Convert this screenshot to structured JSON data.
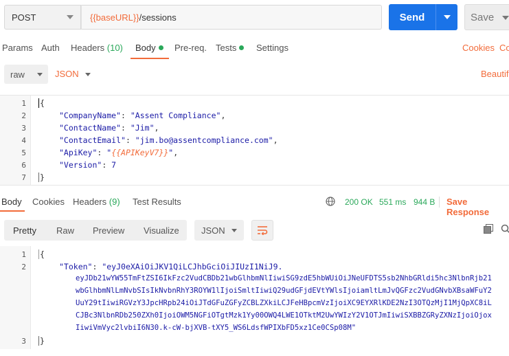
{
  "request": {
    "method": "POST",
    "url_var": "{{baseURL}}",
    "url_path": "/sessions",
    "send_label": "Send",
    "save_label": "Save"
  },
  "request_tabs": {
    "params": "Params",
    "auth": "Auth",
    "headers": "Headers",
    "headers_count": "(10)",
    "body": "Body",
    "prereq": "Pre-req.",
    "tests": "Tests",
    "settings": "Settings",
    "cookies": "Cookies",
    "code": "Co"
  },
  "body_options": {
    "mode": "raw",
    "language": "JSON",
    "beautify": "Beautif"
  },
  "request_body": {
    "lines": [
      {
        "n": "1"
      },
      {
        "n": "2"
      },
      {
        "n": "3"
      },
      {
        "n": "4"
      },
      {
        "n": "5"
      },
      {
        "n": "6"
      },
      {
        "n": "7"
      }
    ],
    "open": "{",
    "close": "}",
    "company_key": "\"CompanyName\"",
    "company_val": "\"Assent Compliance\"",
    "contact_key": "\"ContactName\"",
    "contact_val": "\"Jim\"",
    "email_key": "\"ContactEmail\"",
    "email_val": "\"jim.bo@assentcompliance.com\"",
    "apikey_key": "\"ApiKey\"",
    "apikey_q1": "\"",
    "apikey_var": "{{APIKeyV7}}",
    "apikey_q2": "\"",
    "version_key": "\"Version\"",
    "version_val": "7"
  },
  "response_tabs": {
    "body": "Body",
    "cookies": "Cookies",
    "headers": "Headers",
    "headers_count": "(9)",
    "test_results": "Test Results",
    "status": "200 OK",
    "time": "551 ms",
    "size": "944 B",
    "save_response": "Save Response"
  },
  "response_toolbar": {
    "pretty": "Pretty",
    "raw": "Raw",
    "preview": "Preview",
    "visualize": "Visualize",
    "format": "JSON"
  },
  "response_body": {
    "n1": "1",
    "n2": "2",
    "n3": "3",
    "open": "{",
    "close": "}",
    "token_key": "\"Token\"",
    "token_lines": [
      "\"eyJ0eXAiOiJKV1QiLCJhbGciOiJIUzI1NiJ9.",
      "eyJDb21wYW55TmFtZSI6IkFzc2VudCBDb21wbGlhbmNlIiwiSG9zdE5hbWUiOiJNeUFDTS5sb2NhbGRldi5hc3NlbnRjb21",
      "wbGlhbmNlLmNvbSIsIkNvbnRhY3ROYW1lIjoiSmltIiwiQ29udGFjdEVtYWlsIjoiamltLmJvQGFzc2VudGNvbXBsaWFuY2",
      "UuY29tIiwiRGVzY3JpcHRpb24iOiJTdGFuZGFyZCBLZXkiLCJFeHBpcmVzIjoiXC9EYXRlKDE2NzI3OTQzMjI1MjQpXC8iL",
      "CJBc3NlbnRDb250ZXh0IjoiOWM5NGFiOTgtMzk1Yy00OWQ4LWE1OTktM2UwYWIzY2V1OTJmIiwiSXBBZGRyZXNzIjoiOjox",
      "IiwiVmVyc2lvbiI6N30.k-cW-bjXVB-tXY5_WS6LdsfWPIXbFD5xz1Ce0CSp08M\""
    ]
  }
}
